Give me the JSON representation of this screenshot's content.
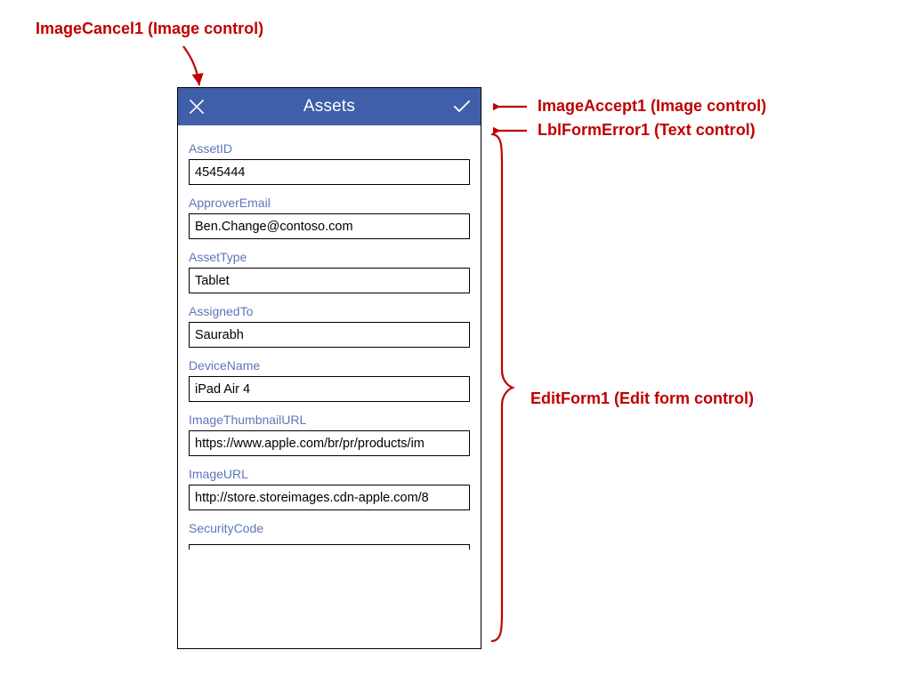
{
  "annotations": {
    "topLeft": "ImageCancel1 (Image control)",
    "right1": "ImageAccept1 (Image control)",
    "right2": "LblFormError1 (Text control)",
    "rightBrace": "EditForm1 (Edit form control)"
  },
  "phone": {
    "title": "Assets",
    "fields": [
      {
        "label": "AssetID",
        "value": "4545444"
      },
      {
        "label": "ApproverEmail",
        "value": "Ben.Change@contoso.com"
      },
      {
        "label": "AssetType",
        "value": "Tablet"
      },
      {
        "label": "AssignedTo",
        "value": "Saurabh"
      },
      {
        "label": "DeviceName",
        "value": "iPad Air 4"
      },
      {
        "label": "ImageThumbnailURL",
        "value": "https://www.apple.com/br/pr/products/im"
      },
      {
        "label": "ImageURL",
        "value": "http://store.storeimages.cdn-apple.com/8"
      },
      {
        "label": "SecurityCode",
        "value": ""
      }
    ]
  }
}
